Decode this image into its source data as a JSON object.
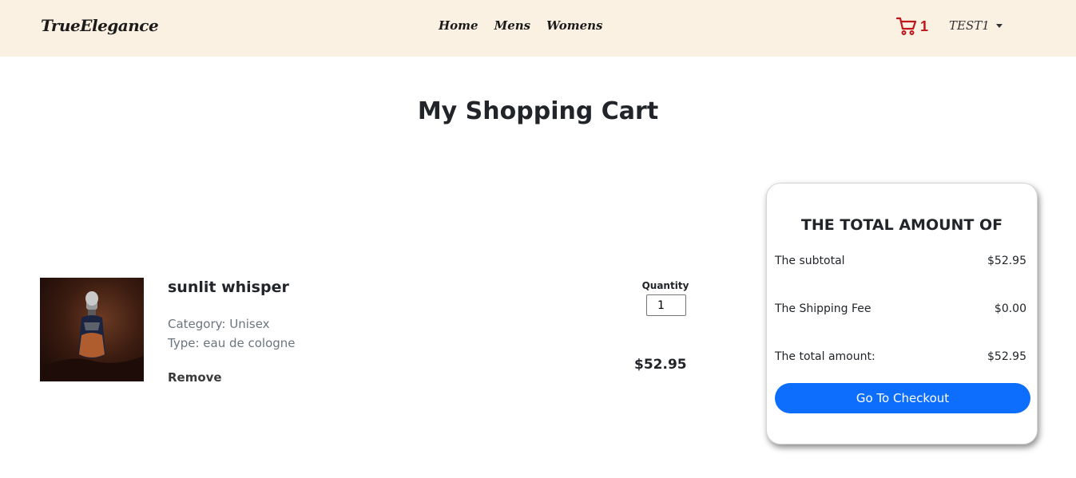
{
  "nav": {
    "brand": "TrueElegance",
    "links": [
      "Home",
      "Mens",
      "Womens"
    ],
    "cart_count": "1",
    "user_name": "TEST1"
  },
  "page": {
    "title": "My Shopping Cart"
  },
  "cart_item": {
    "name": "sunlit whisper",
    "category": "Category: Unisex",
    "type": "Type: eau de cologne",
    "remove_label": "Remove",
    "quantity_label": "Quantity",
    "quantity_value": "1",
    "price": "$52.95"
  },
  "summary": {
    "title": "THE TOTAL AMOUNT OF",
    "subtotal_label": "The subtotal",
    "subtotal_value": "$52.95",
    "shipping_label": "The Shipping Fee",
    "shipping_value": "$0.00",
    "total_label": "The total amount:",
    "total_value": "$52.95",
    "checkout_label": "Go To Checkout"
  },
  "colors": {
    "navbar_bg": "#faf1e3",
    "cart_icon": "#c0151a",
    "primary_button": "#0d6efd"
  },
  "icons": {
    "cart": "shopping-cart-icon",
    "user_caret": "caret-down-icon"
  }
}
